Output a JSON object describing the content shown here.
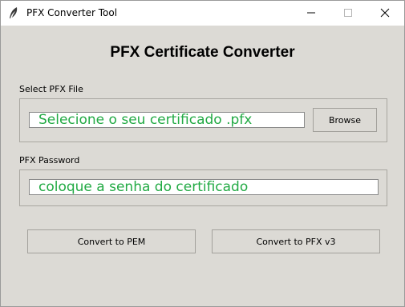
{
  "window": {
    "title": "PFX Converter Tool",
    "app_icon": "feather-icon",
    "controls": [
      "minimize-icon",
      "maximize-icon",
      "close-icon"
    ]
  },
  "heading": "PFX Certificate Converter",
  "file_section": {
    "label": "Select PFX File",
    "input_value": "Selecione o seu certificado .pfx",
    "browse_label": "Browse"
  },
  "password_section": {
    "label": "PFX Password",
    "input_value": "coloque a senha do certificado"
  },
  "actions": {
    "convert_pem_label": "Convert to PEM",
    "convert_pfx_v3_label": "Convert to PFX v3"
  },
  "colors": {
    "window_bg": "#dcdad5",
    "input_text": "#22aa44"
  }
}
